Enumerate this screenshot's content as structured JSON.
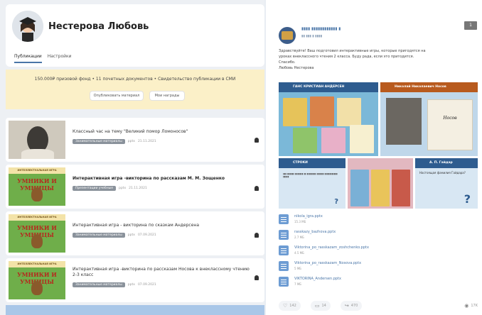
{
  "profile": {
    "name": "Нестерова Любовь",
    "tabs": [
      "Публикации",
      "Настройки"
    ]
  },
  "promo": {
    "text": "150.000₽ призовой фонд • 11 почетных документов • Свидетельство публикации в СМИ",
    "button1": "Опубликовать материал",
    "button2": "Мои награды"
  },
  "cards": [
    {
      "title": "Классный час на тему \"Великий помор Ломоносов\"",
      "tag": "Занимательные материалы",
      "format": "pptx",
      "date": "21.11.2021",
      "thumb": "portrait"
    },
    {
      "title": "Интерактивная игра -викторина по рассказам М. М. Зощенко",
      "tag": "Презентации учебные",
      "format": "pptx",
      "date": "21.11.2021",
      "thumb": "game"
    },
    {
      "title": "Интерактивная игра - викторина по сказкам Андерсена",
      "tag": "Занимательные материалы",
      "format": "pptx",
      "date": "07.09.2021",
      "thumb": "game"
    },
    {
      "title": "Интерактивная игра -викторина по рассказам Носова к внеклассному чтению 2-3 класс",
      "tag": "Занимательные материалы",
      "format": "pptx",
      "date": "07.09.2021",
      "thumb": "game"
    }
  ],
  "game_thumb": {
    "banner": "ИНТЕЛЛЕКТУАЛЬНАЯ ИГРА",
    "title": "УМНИКИ И УМНИЦЫ"
  },
  "post": {
    "more": "1",
    "text_lines": [
      "Здравствуйте! Ваш подготовил интерактивные игры, которые пригодятся на",
      "уроках внеклассного чтения 2 класса. Буду рада, если это пригодится.",
      "Спасибо.",
      "Любовь Нестерова"
    ],
    "tiles": {
      "t1": "ГАНС КРИСТИАН АНДЕРСЕН",
      "t2": "Николай Николаевич Носов",
      "t2_card": "Носов",
      "t3": "СТРОКИ",
      "t5": "А. П. Гайдар",
      "t5_q": "Настоящая фамилия Гайдара?"
    },
    "files": [
      {
        "name": "nikola_igra.pptx",
        "size": "15.3 МБ"
      },
      {
        "name": "rasskazy_bazhova.pptx",
        "size": "2.7 МБ"
      },
      {
        "name": "Viktorina_po_rasskazam_zoshchenko.pptx",
        "size": "4.5 МБ"
      },
      {
        "name": "Viktorina_po_rasskazam_Nosova.pptx",
        "size": "5 МБ"
      },
      {
        "name": "VIKTORINA_Andersen.pptx",
        "size": "7 МБ"
      }
    ],
    "actions": {
      "like": "142",
      "comment": "14",
      "share": "470"
    },
    "views": "17K"
  },
  "colors": {
    "accent": "#4a76a8",
    "promo_bg": "#fbf0c8",
    "tag": "#8a929b"
  },
  "icons": [
    "avatar",
    "bell-icon",
    "file-icon",
    "like-icon",
    "comment-icon",
    "share-icon",
    "eye-icon"
  ]
}
